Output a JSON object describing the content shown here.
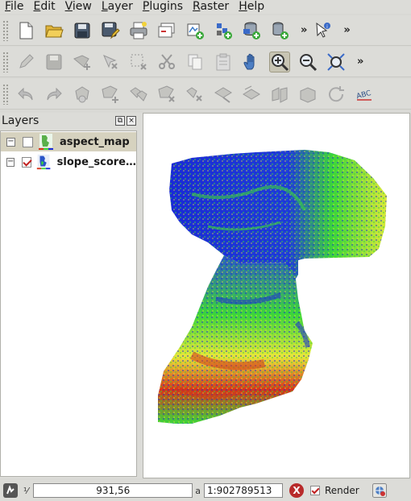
{
  "menu": [
    {
      "label": "File",
      "mnemonic": "F",
      "rest": "ile"
    },
    {
      "label": "Edit",
      "mnemonic": "E",
      "rest": "dit"
    },
    {
      "label": "View",
      "mnemonic": "V",
      "rest": "iew"
    },
    {
      "label": "Layer",
      "mnemonic": "L",
      "rest": "ayer"
    },
    {
      "label": "Plugins",
      "mnemonic": "P",
      "rest": "lugins"
    },
    {
      "label": "Raster",
      "mnemonic": "R",
      "rest": "aster"
    },
    {
      "label": "Help",
      "mnemonic": "H",
      "rest": "elp"
    }
  ],
  "toolbar_overflow": "»",
  "layers_panel": {
    "title": "Layers",
    "float_symbol": "⧉",
    "close_symbol": "×",
    "layers": [
      {
        "name": "aspect_map",
        "checked": false,
        "selected": true
      },
      {
        "name": "slope_score…",
        "checked": true,
        "selected": false
      }
    ]
  },
  "status": {
    "coord_label": "⅟",
    "coordinates": "931,56",
    "scale_label": "a",
    "scale": "1:902789513",
    "stop_symbol": "X",
    "render_label": "Render",
    "render_checked": true
  },
  "colors": {
    "accent_blue": "#1a2bd6",
    "accent_green": "#3bd63a",
    "accent_yellow": "#e6e63a",
    "accent_red": "#d6331a"
  },
  "icons": {
    "toolbar1": [
      "new-project-icon",
      "open-project-icon",
      "save-project-icon",
      "save-as-icon",
      "print-composer-icon",
      "composer-manager-icon",
      "new-shapefile-icon",
      "new-spatialite-icon",
      "add-vector-icon",
      "add-wms-icon",
      "identify-icon"
    ],
    "toolbar2": [
      "edit-pencil-icon",
      "save-edits-icon",
      "add-feature-icon",
      "move-feature-icon",
      "select-delete-icon",
      "cut-icon",
      "copy-icon",
      "paste-icon",
      "pan-icon",
      "zoom-in-icon",
      "zoom-out-icon",
      "zoom-full-icon"
    ],
    "toolbar3": [
      "undo-icon",
      "redo-icon",
      "simplify-icon",
      "add-ring-icon",
      "add-part-icon",
      "delete-ring-icon",
      "delete-part-icon",
      "reshape-icon",
      "offset-curve-icon",
      "split-icon",
      "merge-icon",
      "rotate-icon",
      "label-icon"
    ]
  }
}
